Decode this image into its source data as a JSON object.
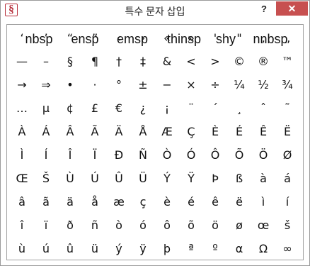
{
  "window": {
    "title": "특수 문자 삽입",
    "app_icon": "§",
    "help_label": "?",
    "close_label": "✕"
  },
  "names": [
    "nbsp",
    "ensp",
    "emsp",
    "thinsp",
    "shy",
    "nnbsp"
  ],
  "rows": [
    [
      "‘",
      "’",
      "“",
      "”",
      "‹",
      "›",
      "«",
      "»",
      "'",
      "\"",
      "‚",
      "„"
    ],
    [
      "—",
      "–",
      "§",
      "¶",
      "†",
      "‡",
      "&",
      "<",
      ">",
      "©",
      "®",
      "™"
    ],
    [
      "→",
      "⇒",
      "•",
      "·",
      "°",
      "±",
      "−",
      "×",
      "÷",
      "¼",
      "½",
      "¾"
    ],
    [
      "…",
      "µ",
      "¢",
      "£",
      "€",
      "¿",
      "¡",
      "¨",
      "´",
      "¸",
      "ˆ",
      "˜"
    ],
    [
      "À",
      "Á",
      "Â",
      "Ã",
      "Ä",
      "Å",
      "Æ",
      "Ç",
      "È",
      "É",
      "Ê",
      "Ë"
    ],
    [
      "Ì",
      "Í",
      "Î",
      "Ï",
      "Ð",
      "Ñ",
      "Ò",
      "Ó",
      "Ô",
      "Õ",
      "Ö",
      "Ø"
    ],
    [
      "Œ",
      "Š",
      "Ù",
      "Ú",
      "Û",
      "Ü",
      "Ý",
      "Ÿ",
      "Þ",
      "ß",
      "à",
      "á"
    ],
    [
      "â",
      "ã",
      "ä",
      "å",
      "æ",
      "ç",
      "è",
      "é",
      "ê",
      "ë",
      "ì",
      "í"
    ],
    [
      "î",
      "ï",
      "ð",
      "ñ",
      "ò",
      "ó",
      "ô",
      "õ",
      "ö",
      "ø",
      "œ",
      "š"
    ],
    [
      "ù",
      "ú",
      "û",
      "ü",
      "ý",
      "ÿ",
      "þ",
      "ª",
      "º",
      "α",
      "Ω",
      "∞"
    ]
  ]
}
